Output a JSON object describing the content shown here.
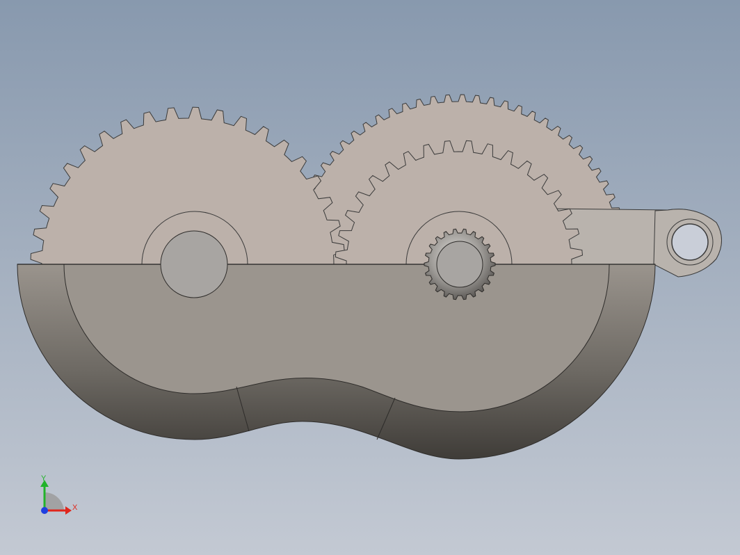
{
  "viewport": {
    "background_top": "#8899ae",
    "background_bottom": "#c3c9d3"
  },
  "colors": {
    "gear_fill": "#bcb1aa",
    "gear_stroke": "#3a3a3a",
    "housing_face": "#9b958e",
    "housing_shadow": "#4a4743",
    "shaft_fill": "#a8a5a2",
    "splined_shaft": "#8f8c89",
    "lever_fill": "#b9b3ad"
  },
  "model": {
    "parts": [
      {
        "name": "large-spur-gear-left",
        "teeth": 40
      },
      {
        "name": "large-spur-gear-right-rear",
        "teeth": 72
      },
      {
        "name": "spur-gear-right-front",
        "teeth": 36
      },
      {
        "name": "splined-pinion",
        "teeth": 22
      },
      {
        "name": "lever-arm"
      },
      {
        "name": "gear-housing"
      }
    ]
  },
  "triad": {
    "x_label": "X",
    "y_label": "Y",
    "x_color": "#e0261c",
    "y_color": "#22b32a",
    "z_color": "#1f3fe0"
  }
}
